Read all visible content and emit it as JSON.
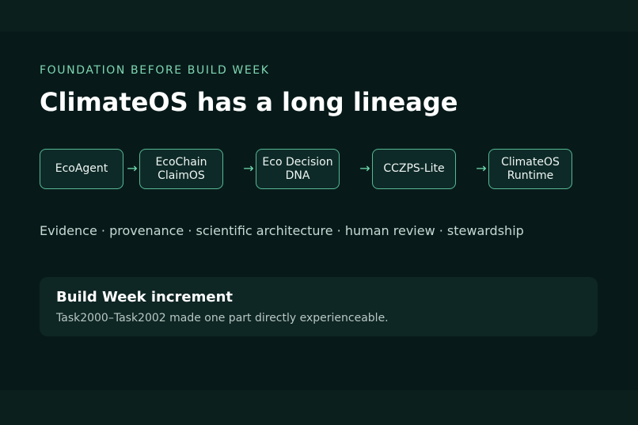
{
  "kicker": "FOUNDATION BEFORE BUILD WEEK",
  "title": "ClimateOS has a long lineage",
  "lineage": {
    "steps": [
      "EcoAgent",
      "EcoChain\nClaimOS",
      "Eco Decision\nDNA",
      "CCZPS-Lite",
      "ClimateOS\nRuntime"
    ],
    "arrow_glyph": "→"
  },
  "tagline": "Evidence · provenance · scientific architecture · human review · stewardship",
  "increment": {
    "title": "Build Week increment",
    "text": "Task2000–Task2002 made one part directly experienceable."
  },
  "colors": {
    "background": "#071a19",
    "accent": "#7fd6b2",
    "box_border": "#57b894"
  }
}
